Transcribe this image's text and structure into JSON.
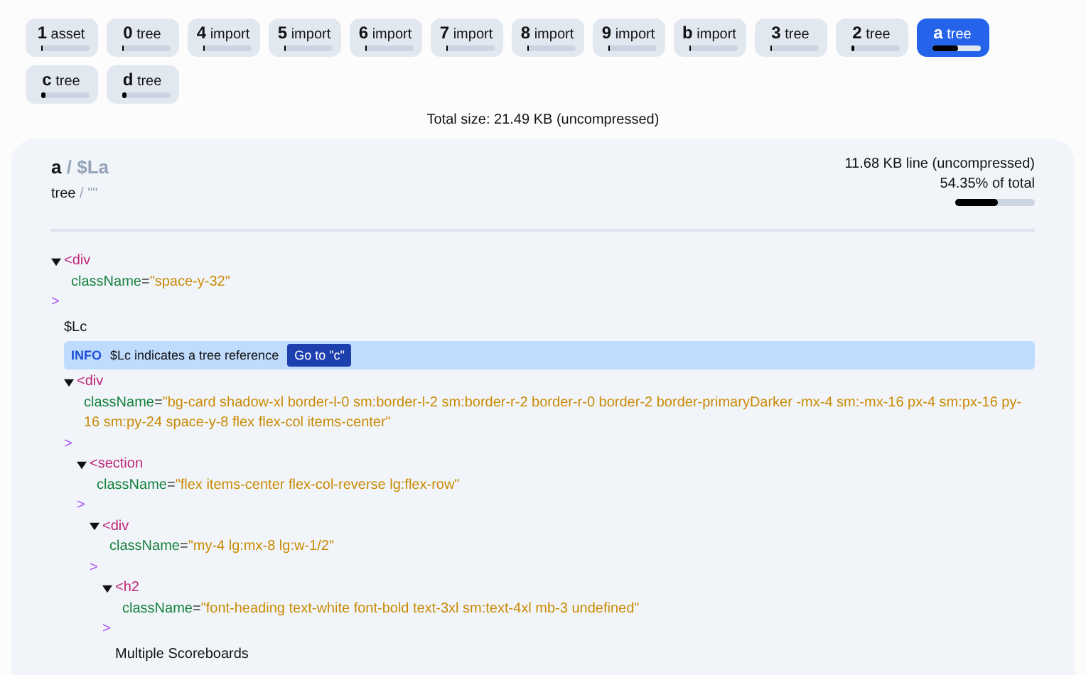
{
  "chunks": [
    {
      "id": "1",
      "kind": "asset",
      "selected": false,
      "level": 0.02
    },
    {
      "id": "0",
      "kind": "tree",
      "selected": false,
      "level": 0.02
    },
    {
      "id": "4",
      "kind": "import",
      "selected": false,
      "level": 0.02
    },
    {
      "id": "5",
      "kind": "import",
      "selected": false,
      "level": 0.02
    },
    {
      "id": "6",
      "kind": "import",
      "selected": false,
      "level": 0.02
    },
    {
      "id": "7",
      "kind": "import",
      "selected": false,
      "level": 0.02
    },
    {
      "id": "8",
      "kind": "import",
      "selected": false,
      "level": 0.02
    },
    {
      "id": "9",
      "kind": "import",
      "selected": false,
      "level": 0.02
    },
    {
      "id": "b",
      "kind": "import",
      "selected": false,
      "level": 0.02
    },
    {
      "id": "3",
      "kind": "tree",
      "selected": false,
      "level": 0.04
    },
    {
      "id": "2",
      "kind": "tree",
      "selected": false,
      "level": 0.07
    },
    {
      "id": "a",
      "kind": "tree",
      "selected": true,
      "level": 0.54
    },
    {
      "id": "c",
      "kind": "tree",
      "selected": false,
      "level": 0.08
    },
    {
      "id": "d",
      "kind": "tree",
      "selected": false,
      "level": 0.08
    }
  ],
  "total_size": "Total size: 21.49 KB (uncompressed)",
  "detail": {
    "id": "a",
    "id_separator": "/",
    "ref": "$La",
    "kind": "tree",
    "kind_separator": "/",
    "key": "\"\"",
    "size": "11.68 KB line (uncompressed)",
    "share": "54.35% of total",
    "level": 0.54
  },
  "tree": {
    "kind": "element",
    "tag": "<div",
    "attribute": {
      "name": "className",
      "equals": "=",
      "value": "\"space-y-32\""
    },
    "close": ">",
    "expanded": true,
    "children": [
      {
        "kind": "text",
        "text": "$Lc"
      },
      {
        "kind": "info",
        "label": "INFO",
        "message": "$Lc indicates a tree reference",
        "button": "Go to \"c\""
      },
      {
        "kind": "element",
        "tag": "<div",
        "attribute": {
          "name": "className",
          "equals": "=",
          "value": "\"bg-card shadow-xl border-l-0 sm:border-l-2 sm:border-r-2 border-r-0 border-2 border-primaryDarker -mx-4 sm:-mx-16 px-4 sm:px-16 py-16 sm:py-24 space-y-8 flex flex-col items-center\""
        },
        "close": ">",
        "expanded": true,
        "children": [
          {
            "kind": "element",
            "tag": "<section",
            "attribute": {
              "name": "className",
              "equals": "=",
              "value": "\"flex items-center flex-col-reverse lg:flex-row\""
            },
            "close": ">",
            "expanded": true,
            "children": [
              {
                "kind": "element",
                "tag": "<div",
                "attribute": {
                  "name": "className",
                  "equals": "=",
                  "value": "\"my-4 lg:mx-8 lg:w-1/2\""
                },
                "close": ">",
                "expanded": true,
                "children": [
                  {
                    "kind": "element",
                    "tag": "<h2",
                    "attribute": {
                      "name": "className",
                      "equals": "=",
                      "value": "\"font-heading text-white font-bold text-3xl sm:text-4xl mb-3 undefined\""
                    },
                    "close": ">",
                    "expanded": true,
                    "children": [
                      {
                        "kind": "text",
                        "text": "Multiple Scoreboards"
                      }
                    ]
                  }
                ]
              }
            ]
          }
        ]
      }
    ]
  }
}
